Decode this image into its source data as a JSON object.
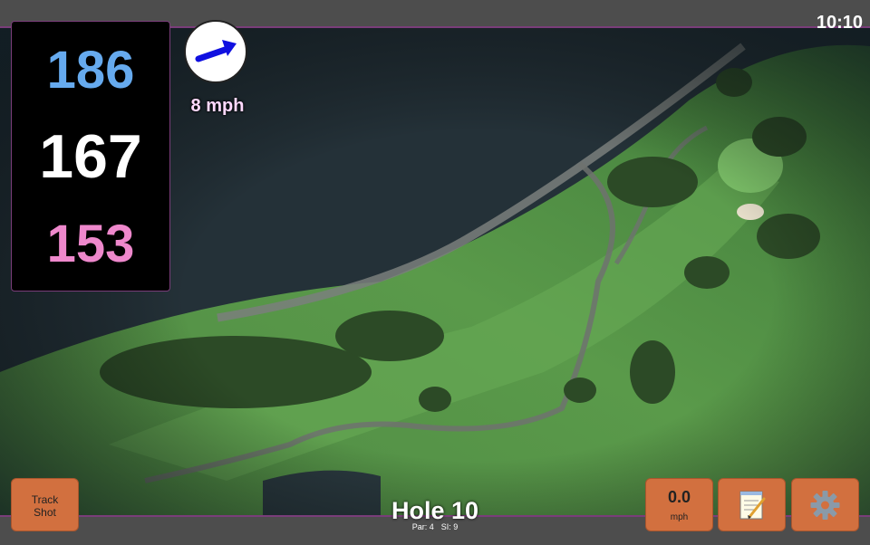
{
  "header": {
    "time": "10:10"
  },
  "distances": {
    "back": "186",
    "middle": "167",
    "front": "153"
  },
  "wind": {
    "speed": "8 mph",
    "icon": "wind-direction-arrow-icon"
  },
  "hole": {
    "title": "Hole 10",
    "par_label": "Par: 4",
    "si_label": "SI: 9"
  },
  "buttons": {
    "track_shot": "Track Shot",
    "speed_value": "0.0",
    "speed_unit": "mph",
    "notes_icon": "notepad-icon",
    "settings_icon": "gear-icon"
  },
  "colors": {
    "back_distance": "#66aaee",
    "middle_distance": "#ffffff",
    "front_distance": "#ee88cc",
    "button_bg": "#d2703f",
    "accent_border": "#7a3d7a"
  }
}
